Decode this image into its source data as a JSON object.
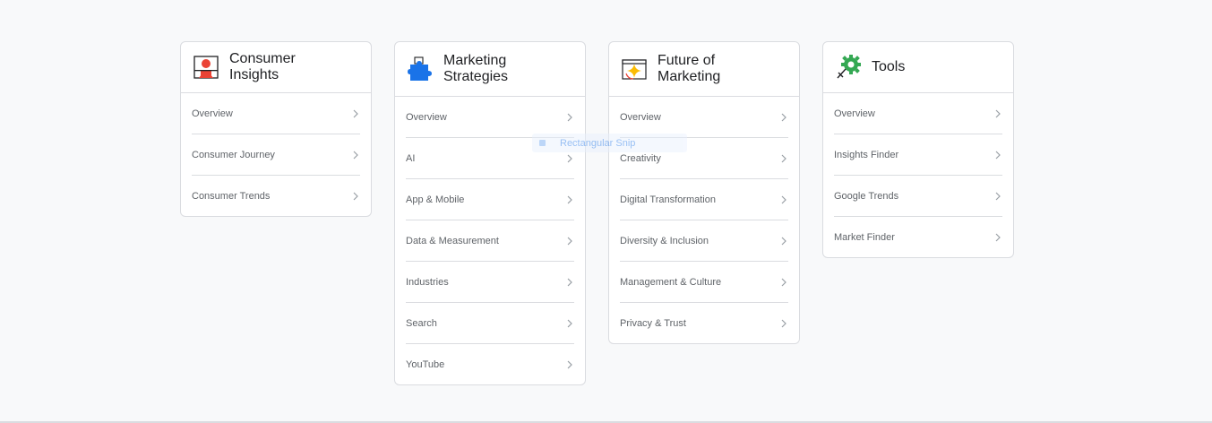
{
  "cards": [
    {
      "title": "Consumer Insights",
      "icon": "person-insights-icon",
      "links": [
        "Overview",
        "Consumer Journey",
        "Consumer Trends"
      ]
    },
    {
      "title": "Marketing Strategies",
      "icon": "puzzle-piece-icon",
      "links": [
        "Overview",
        "AI",
        "App & Mobile",
        "Data & Measurement",
        "Industries",
        "Search",
        "YouTube"
      ]
    },
    {
      "title": "Future of Marketing",
      "icon": "sparkle-browser-icon",
      "links": [
        "Overview",
        "Creativity",
        "Digital Transformation",
        "Diversity & Inclusion",
        "Management & Culture",
        "Privacy & Trust"
      ]
    },
    {
      "title": "Tools",
      "icon": "gear-tools-icon",
      "links": [
        "Overview",
        "Insights Finder",
        "Google Trends",
        "Market Finder"
      ]
    }
  ],
  "overlay": {
    "text": "Rectangular Snip"
  },
  "colors": {
    "background": "#f8f9fa",
    "border": "#dadce0",
    "title": "#202124",
    "link": "#5f6368",
    "chevron": "#9aa0a6"
  }
}
